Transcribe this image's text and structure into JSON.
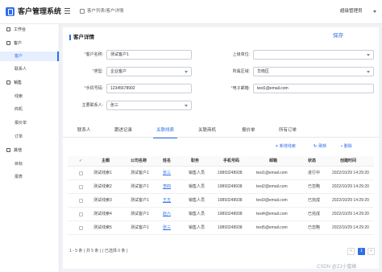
{
  "app": {
    "title": "客户管理系统"
  },
  "header": {
    "breadcrumb": "客户列表/客户详情",
    "user_name": "超级管理员"
  },
  "sidebar": {
    "groups": [
      {
        "label": "工作台",
        "icon": "dashboard-icon",
        "items": []
      },
      {
        "label": "客户",
        "icon": "customer-icon",
        "items": [
          {
            "label": "客户",
            "active": true
          },
          {
            "label": "联系人",
            "active": false
          }
        ]
      },
      {
        "label": "销售",
        "icon": "sales-icon",
        "items": [
          {
            "label": "线索",
            "active": false
          },
          {
            "label": "商机",
            "active": false
          },
          {
            "label": "报价单",
            "active": false
          },
          {
            "label": "订单",
            "active": false
          }
        ]
      },
      {
        "label": "其他",
        "icon": "other-icon",
        "items": [
          {
            "label": "目标",
            "active": false
          },
          {
            "label": "报表",
            "active": false
          }
        ]
      }
    ]
  },
  "detail": {
    "title": "客户详情",
    "save_label": "保存",
    "fields": {
      "customer_name": {
        "label": "客户名称:",
        "value": "测试客户1"
      },
      "type": {
        "label": "类型:",
        "value": "企业客户"
      },
      "phone": {
        "label": "手机号码:",
        "value": "12345678902"
      },
      "primary_contact": {
        "label": "主要联系人:",
        "value": "张三"
      },
      "parent_unit": {
        "label": "上级单位:",
        "value": ""
      },
      "region": {
        "label": "所属区域:",
        "value": "华南区"
      },
      "email": {
        "label": "电子邮箱:",
        "value": "test1@email.com"
      }
    }
  },
  "tabs": [
    {
      "label": "联系人",
      "active": false
    },
    {
      "label": "跟进记录",
      "active": false
    },
    {
      "label": "关联线索",
      "active": true
    },
    {
      "label": "关联商机",
      "active": false
    },
    {
      "label": "报价单",
      "active": false
    },
    {
      "label": "所有订单",
      "active": false
    }
  ],
  "toolbar": {
    "add_label": "新增线索",
    "refresh_label": "刷新",
    "delete_label": "删除"
  },
  "table": {
    "columns": [
      "",
      "主题",
      "公司名称",
      "姓名",
      "职务",
      "手机号码",
      "邮箱",
      "状态",
      "创建时间"
    ],
    "rows": [
      {
        "subject": "测试线索1",
        "company": "测试客户1",
        "name": "张三",
        "position": "销售人员",
        "phone": "19893248938",
        "email": "test1@email.com",
        "status": "进行中",
        "created": "2022/10/29 14:29:20"
      },
      {
        "subject": "测试线索2",
        "company": "测试客户1",
        "name": "李四",
        "position": "销售人员",
        "phone": "19893248938",
        "email": "test2@email.com",
        "status": "已忽略",
        "created": "2022/10/29 14:29:20"
      },
      {
        "subject": "测试线索3",
        "company": "测试客户1",
        "name": "王五",
        "position": "销售人员",
        "phone": "19893248938",
        "email": "test3@email.com",
        "status": "已完成",
        "created": "2022/10/29 14:29:20"
      },
      {
        "subject": "测试线索4",
        "company": "测试客户1",
        "name": "赵六",
        "position": "销售人员",
        "phone": "19893248938",
        "email": "test4@email.com",
        "status": "已完成",
        "created": "2022/10/29 14:29:20"
      },
      {
        "subject": "测试线索5",
        "company": "测试客户1",
        "name": "张三",
        "position": "销售人员",
        "phone": "19893248938",
        "email": "test5@email.com",
        "status": "已忽略",
        "created": "2022/10/29 14:29:20"
      }
    ]
  },
  "pagination": {
    "summary": "1 - 5 条 ( 共 5 条 ) ( 已选择 0 条 )",
    "prev": "<",
    "page": "1",
    "next": ">"
  },
  "footer": {
    "watermark": "CSDN @ZJ小蜜蜂"
  },
  "colors": {
    "accent": "#2f6ee8"
  }
}
